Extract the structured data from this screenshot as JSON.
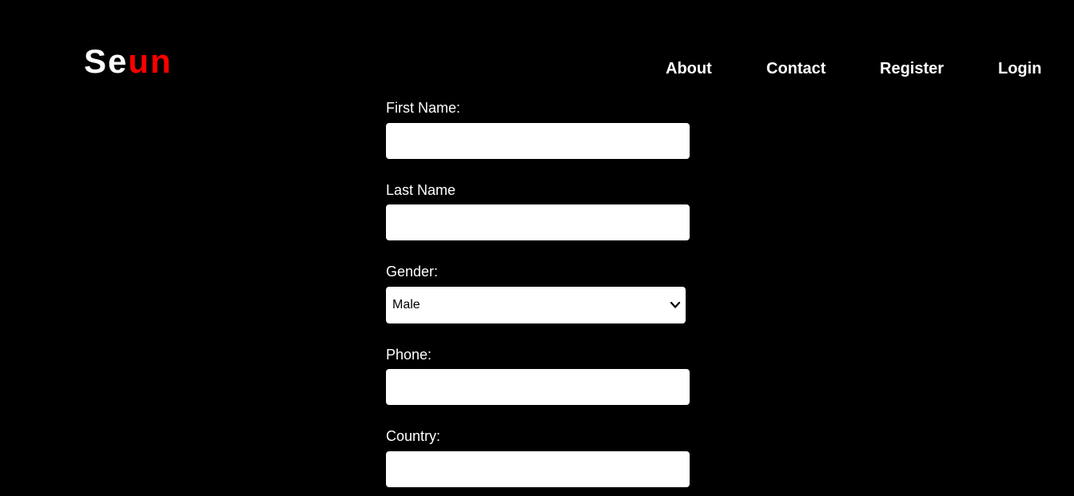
{
  "brand": {
    "part_a": "Se",
    "part_b": "un",
    "accent_color": "#ff0000"
  },
  "nav": {
    "items": [
      {
        "label": "About"
      },
      {
        "label": "Contact"
      },
      {
        "label": "Register"
      },
      {
        "label": "Login"
      }
    ]
  },
  "form": {
    "first_name": {
      "label": "First Name:",
      "value": ""
    },
    "last_name": {
      "label": "Last Name",
      "value": ""
    },
    "gender": {
      "label": "Gender:",
      "selected": "Male",
      "icon": "chevron-down-icon"
    },
    "phone": {
      "label": "Phone:",
      "value": ""
    },
    "country": {
      "label": "Country:",
      "value": ""
    }
  }
}
